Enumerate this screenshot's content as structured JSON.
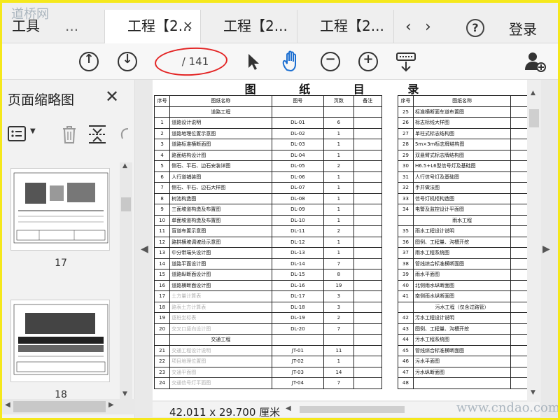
{
  "tabs": [
    {
      "label": "工具",
      "active": false
    },
    {
      "label": "...",
      "active": false
    },
    {
      "label": "工程【2...",
      "active": true,
      "close": "×"
    },
    {
      "label": "工程【2...",
      "active": false
    },
    {
      "label": "工程【2...",
      "active": false
    }
  ],
  "header": {
    "help": "?",
    "login": "登录",
    "prev_tabs": "‹",
    "next_tabs": "›"
  },
  "toolbar": {
    "page_current": "",
    "page_total": "/ 141"
  },
  "sidebar": {
    "title": "页面缩略图",
    "close": "✕",
    "thumbnails": [
      {
        "page": "17"
      },
      {
        "page": "18"
      }
    ]
  },
  "sheet": {
    "title": "图 纸 目 录",
    "headers_left": [
      "序号",
      "图纸名称",
      "图号",
      "页数",
      "备注"
    ],
    "headers_right": [
      "序号",
      "图纸名称"
    ],
    "rows_left": [
      {
        "no": "",
        "name": "道路工程",
        "code": "",
        "pages": "",
        "section": true
      },
      {
        "no": "1",
        "name": "道路设计说明",
        "code": "DL-01",
        "pages": "6"
      },
      {
        "no": "2",
        "name": "道路地理位置示意图",
        "code": "DL-02",
        "pages": "1"
      },
      {
        "no": "3",
        "name": "道路标准横断面图",
        "code": "DL-03",
        "pages": "1"
      },
      {
        "no": "4",
        "name": "路面结构设计图",
        "code": "DL-04",
        "pages": "1"
      },
      {
        "no": "5",
        "name": "侧石、平石、边石安装详图",
        "code": "DL-05",
        "pages": "2"
      },
      {
        "no": "6",
        "name": "人行道铺装图",
        "code": "DL-06",
        "pages": "1"
      },
      {
        "no": "7",
        "name": "侧石、平石、边石大样图",
        "code": "DL-07",
        "pages": "1"
      },
      {
        "no": "8",
        "name": "树池构造图",
        "code": "DL-08",
        "pages": "1"
      },
      {
        "no": "9",
        "name": "三面坡道构造及布置图",
        "code": "DL-09",
        "pages": "1"
      },
      {
        "no": "10",
        "name": "单面坡道构造及布置图",
        "code": "DL-10",
        "pages": "1"
      },
      {
        "no": "11",
        "name": "盲道布置示意图",
        "code": "DL-11",
        "pages": "2"
      },
      {
        "no": "12",
        "name": "路拱横坡调坡段示意图",
        "code": "DL-12",
        "pages": "1"
      },
      {
        "no": "13",
        "name": "中分带端头设计图",
        "code": "DL-13",
        "pages": "1"
      },
      {
        "no": "14",
        "name": "道路平面设计图",
        "code": "DL-14",
        "pages": "7"
      },
      {
        "no": "15",
        "name": "道路纵断面设计图",
        "code": "DL-15",
        "pages": "8"
      },
      {
        "no": "16",
        "name": "道路横断面设计图",
        "code": "DL-16",
        "pages": "19"
      },
      {
        "no": "17",
        "name": "土方量计算表",
        "code": "DL-17",
        "pages": "3",
        "faint": true
      },
      {
        "no": "18",
        "name": "路表土方计算表",
        "code": "DL-18",
        "pages": "3",
        "faint": true
      },
      {
        "no": "19",
        "name": "逐桩坐标表",
        "code": "DL-19",
        "pages": "2",
        "faint": true
      },
      {
        "no": "20",
        "name": "交叉口竖向设计图",
        "code": "DL-20",
        "pages": "7",
        "faint": true
      },
      {
        "no": "",
        "name": "交通工程",
        "code": "",
        "pages": "",
        "section": true
      },
      {
        "no": "21",
        "name": "交通工程设计说明",
        "code": "JT-01",
        "pages": "11",
        "faint": true
      },
      {
        "no": "22",
        "name": "项目地理位置图",
        "code": "JT-02",
        "pages": "1",
        "faint": true
      },
      {
        "no": "23",
        "name": "交通平面图",
        "code": "JT-03",
        "pages": "14",
        "faint": true
      },
      {
        "no": "24",
        "name": "交通信号灯平面图",
        "code": "JT-04",
        "pages": "7",
        "faint": true
      }
    ],
    "rows_right": [
      {
        "no": "25",
        "name": "标准横断面车道布置图"
      },
      {
        "no": "26",
        "name": "标志标线大样图"
      },
      {
        "no": "27",
        "name": "单柱式标志结构图"
      },
      {
        "no": "28",
        "name": "5m×3m标志牌结构图"
      },
      {
        "no": "29",
        "name": "双悬臂式标志牌结构图"
      },
      {
        "no": "30",
        "name": "H6.5+L6型信号灯及基础图"
      },
      {
        "no": "31",
        "name": "人行信号灯及基础图"
      },
      {
        "no": "32",
        "name": "手井做法图"
      },
      {
        "no": "33",
        "name": "信号灯机柜构造图"
      },
      {
        "no": "34",
        "name": "电警及监控设计平面图"
      },
      {
        "no": "",
        "name": "雨水工程",
        "section": true
      },
      {
        "no": "35",
        "name": "雨水工程设计说明"
      },
      {
        "no": "36",
        "name": "图例、工程量、沟槽开挖"
      },
      {
        "no": "37",
        "name": "雨水工程系统图"
      },
      {
        "no": "38",
        "name": "管线综合标准横断面图"
      },
      {
        "no": "39",
        "name": "雨水平面图"
      },
      {
        "no": "40",
        "name": "北侧雨水纵断面图"
      },
      {
        "no": "41",
        "name": "南侧雨水纵断面图",
        "faint_prefix": true
      },
      {
        "no": "",
        "name": "污水工程（仅含过路管）",
        "section": true
      },
      {
        "no": "42",
        "name": "污水工程设计说明",
        "faint_prefix": true
      },
      {
        "no": "43",
        "name": "图例、工程量、沟槽开挖"
      },
      {
        "no": "44",
        "name": "污水工程系统图",
        "faint_prefix": true
      },
      {
        "no": "45",
        "name": "管线综合标准横断面图"
      },
      {
        "no": "46",
        "name": "污水平面图",
        "faint_prefix": true
      },
      {
        "no": "47",
        "name": "污水纵断面图",
        "faint_prefix": true
      },
      {
        "no": "48",
        "name": ""
      }
    ]
  },
  "status": {
    "dimensions": "42.011 x 29.700 厘米"
  },
  "watermarks": {
    "top_left": "道桥网",
    "bottom_right": "www.cndao.com"
  },
  "colors": {
    "frame": "#f5e81c",
    "annotation_ellipse": "#e32424",
    "hand_tool": "#1c6fd1"
  }
}
